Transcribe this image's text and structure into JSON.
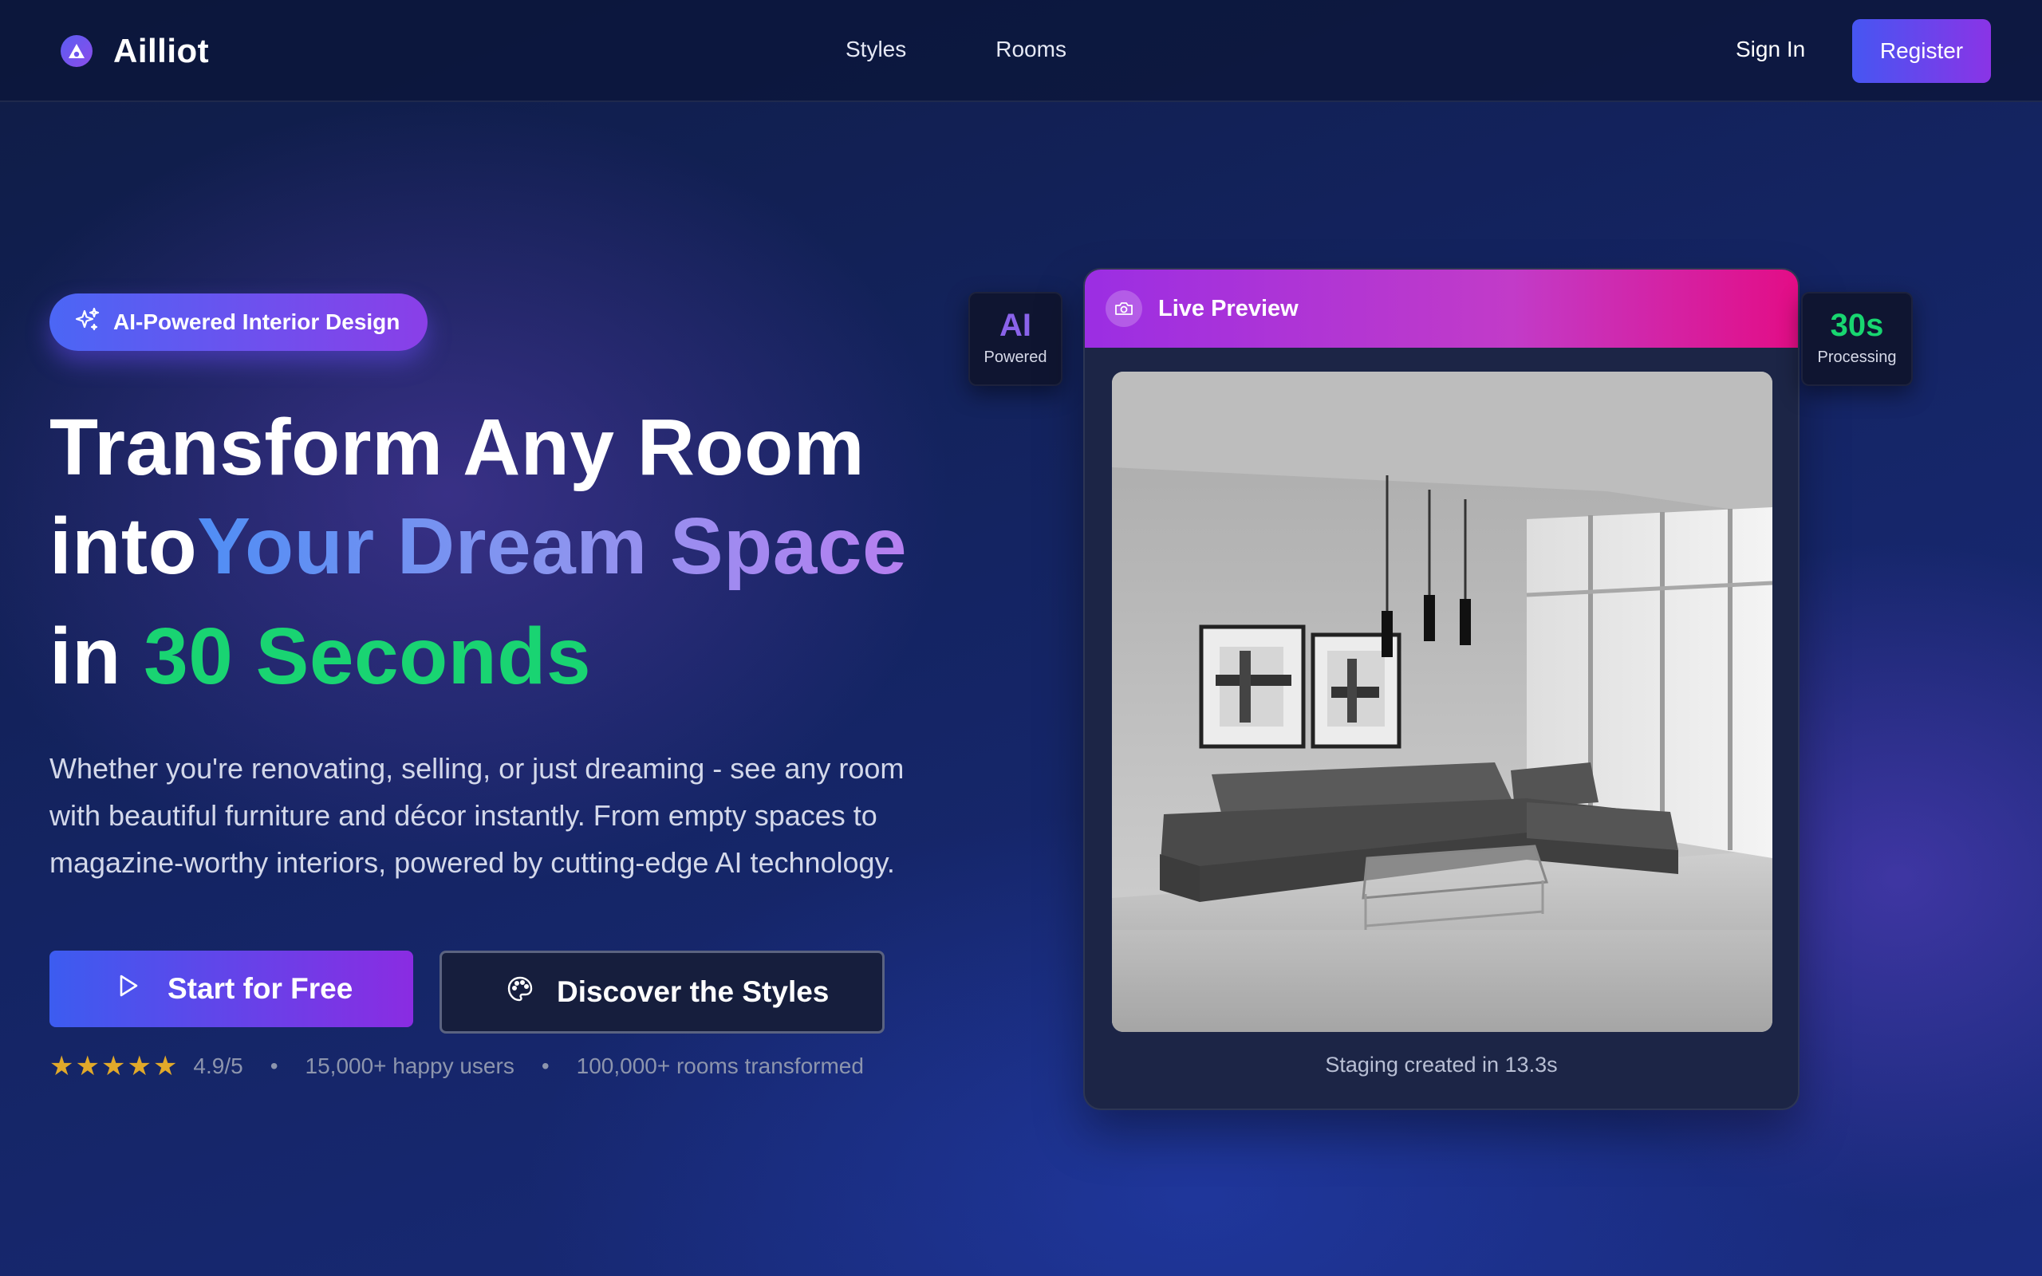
{
  "brand": {
    "name": "Ailliot"
  },
  "nav": {
    "links": [
      "Styles",
      "Rooms"
    ],
    "sign_in": "Sign In",
    "register": "Register"
  },
  "hero": {
    "badge": "AI-Powered Interior Design",
    "headline": {
      "line1": "Transform Any Room",
      "line2_prefix": "into",
      "line2_highlight": "Your Dream Space",
      "line3_prefix": "in ",
      "line3_highlight": "30 Seconds"
    },
    "description": "Whether you're renovating, selling, or just dreaming - see any room with beautiful furniture and décor instantly. From empty spaces to magazine-worthy interiors, powered by cutting-edge AI technology.",
    "primary_cta": "Start for Free",
    "secondary_cta": "Discover the Styles",
    "rating": {
      "stars": 5,
      "score": "4.9/5",
      "users": "15,000+ happy users",
      "rooms": "100,000+ rooms transformed",
      "separator": "•"
    }
  },
  "preview": {
    "title": "Live Preview",
    "caption": "Staging created in 13.3s",
    "stat_ai": {
      "value": "AI",
      "label": "Powered"
    },
    "stat_time": {
      "value": "30s",
      "label": "Processing"
    }
  },
  "colors": {
    "accent_blue": "#3c5cf0",
    "accent_purple": "#8a2ce2",
    "accent_green": "#19d472",
    "accent_pink": "#e30d86",
    "star": "#e1a92a"
  },
  "icons": {
    "logo": "ailliot-logo-icon",
    "badge": "sparkles-icon",
    "primary_cta": "play-icon",
    "secondary_cta": "palette-icon",
    "preview_header": "camera-icon"
  }
}
